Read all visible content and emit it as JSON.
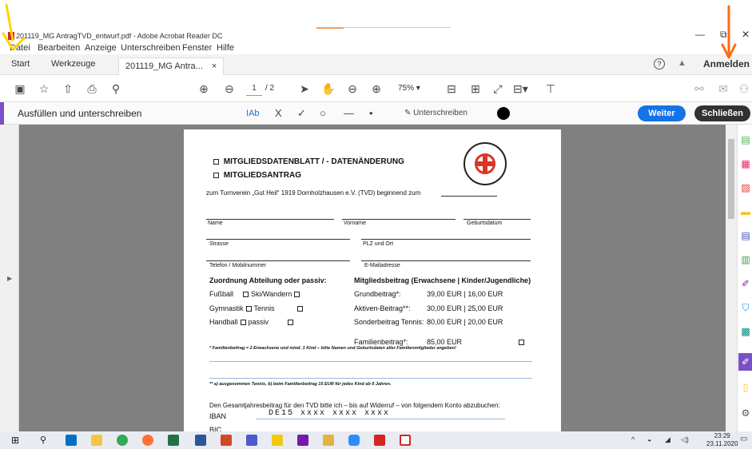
{
  "window": {
    "title": "201119_MG AntragTVD_entwurf.pdf - Adobe Acrobat Reader DC",
    "minimize": "—",
    "maximize": "⧉",
    "close": "✕"
  },
  "menu": [
    "Datei",
    "Bearbeiten",
    "Anzeige",
    "Unterschreiben",
    "Fenster",
    "Hilfe"
  ],
  "tabs": {
    "start": "Start",
    "tools": "Werkzeuge",
    "document": "201119_MG Antra...",
    "document_close": "×",
    "help": "?",
    "bell": "🔔",
    "login": "Anmelden"
  },
  "toolbar": {
    "page_current": "1",
    "page_total": "/ 2",
    "zoom": "75%"
  },
  "fillsign": {
    "label": "Ausfüllen und unterschreiben",
    "text_tool": "Ab",
    "x_tool": "X",
    "check_tool": "✓",
    "circle_tool": "○",
    "line_tool": "—",
    "dot_tool": "•",
    "sign": "Unterschreiben",
    "next": "Weiter",
    "close": "Schließen"
  },
  "form": {
    "heading1": "MITGLIEDSDATENBLATT / - DATENÄNDERUNG",
    "heading2": "MITGLIEDSANTRAG",
    "intro": "zum Turnverein „Gut Heil“ 1919 Dornholzhausen e.V. (TVD) beginnend zum",
    "f_name": "Name",
    "f_vorname": "Vorname",
    "f_geburtsdatum": "Geburtsdatum",
    "f_strasse": "Strasse",
    "f_plz": "PLZ und Ort",
    "f_telefon": "Telefon / Mobilnummer",
    "f_email": "E-Mailadresse",
    "section_abteilung": "Zuordnung Abteilung oder passiv:",
    "section_beitrag": "Mitgliedsbeitrag (Erwachsene | Kinder/Jugendliche)",
    "dep_fussball": "Fußball",
    "dep_ski": "Ski/Wandern",
    "dep_gymnastik": "Gymnastik",
    "dep_tennis": "Tennis",
    "dep_handball": "Handball",
    "dep_passiv": "passiv",
    "fee_grund_label": "Grundbeitrag*:",
    "fee_grund_value": "39,00 EUR | 16,00 EUR",
    "fee_aktiv_label": "Aktiven-Beitrag**:",
    "fee_aktiv_value": "30,00 EUR | 25,00 EUR",
    "fee_sonder_label": "Sonderbeitrag Tennis:",
    "fee_sonder_value": "80,00 EUR | 20,00 EUR",
    "fee_familie_label": "Familienbeitrag*:",
    "fee_familie_value": "85,00 EUR",
    "note1": "* Familienbeitrag = 2 Erwachsene und mind. 1 Kind – bitte Namen und Geburtsdaten aller Familienmitglieder angeben!",
    "note2": "** a) ausgenommen Tennis, b) beim Familienbeitrag 15 EUR für jedes Kind ab 6 Jahren.",
    "bank_text": "Den Gesamtjahresbeitrag für den TVD bitte ich – bis auf Widerruf – von folgendem Konto abzubuchen:",
    "iban_label": "IBAN",
    "iban_value": "DE15  xxxx  xxxx  xxxx",
    "bic_label": "BIC",
    "logo_text": "Turnverein „Gut Heil“ 1919 Dornholzhausen e.V."
  },
  "taskbar": {
    "time": "23:29",
    "date": "23.11.2020"
  },
  "colors": {
    "accent_purple": "#7b4fc7",
    "weiter_blue": "#1473e6",
    "annotation_yellow": "#ffd400",
    "annotation_orange": "#ff6a13"
  }
}
